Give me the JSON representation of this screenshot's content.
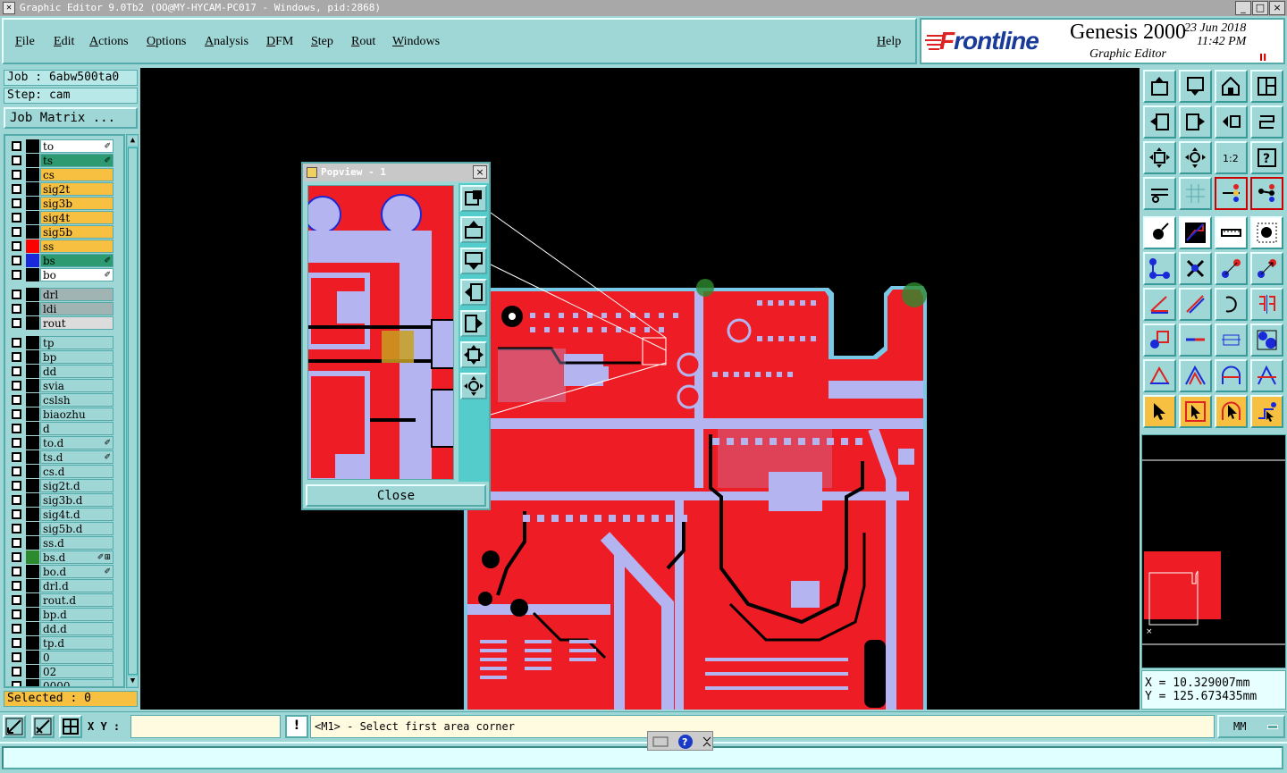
{
  "window": {
    "title": "Graphic Editor 9.0Tb2 (OO@MY-HYCAM-PC017 - Windows, pid:2868)",
    "minimize": "_",
    "maximize": "□",
    "close": "×"
  },
  "menu": [
    "File",
    "Edit",
    "Actions",
    "Options",
    "Analysis",
    "DFM",
    "Step",
    "Rout",
    "Windows"
  ],
  "help_label": "Help",
  "logo": {
    "brand": "Frontline",
    "product": "Genesis 2000",
    "subtitle": "Graphic Editor",
    "date": "23 Jun 2018",
    "time": "11:42 PM",
    "pause": "II"
  },
  "job": {
    "job_label": "Job : 6abw500ta0",
    "step_label": "Step: cam",
    "matrix_button": "Job Matrix ..."
  },
  "layers": [
    {
      "name": "to",
      "bg": "#ffffff",
      "swatch": "#000000",
      "marker": "✐"
    },
    {
      "name": "ts",
      "bg": "#2e9a72",
      "swatch": "#000000",
      "marker": "✐"
    },
    {
      "name": "cs",
      "bg": "#f7c040",
      "swatch": "#000000",
      "marker": ""
    },
    {
      "name": "sig2t",
      "bg": "#f7c040",
      "swatch": "#000000",
      "marker": ""
    },
    {
      "name": "sig3b",
      "bg": "#f7c040",
      "swatch": "#000000",
      "marker": ""
    },
    {
      "name": "sig4t",
      "bg": "#f7c040",
      "swatch": "#000000",
      "marker": ""
    },
    {
      "name": "sig5b",
      "bg": "#f7c040",
      "swatch": "#000000",
      "marker": ""
    },
    {
      "name": "ss",
      "bg": "#f7c040",
      "swatch": "#ff0000",
      "marker": ""
    },
    {
      "name": "bs",
      "bg": "#2e9a72",
      "swatch": "#1a2ad8",
      "marker": "✐"
    },
    {
      "name": "bo",
      "bg": "#ffffff",
      "swatch": "#000000",
      "marker": "✐"
    },
    {
      "name": "drl",
      "bg": "#a0b4b4",
      "swatch": "#000000",
      "marker": ""
    },
    {
      "name": "ldi",
      "bg": "#a0b4b4",
      "swatch": "#000000",
      "marker": ""
    },
    {
      "name": "rout",
      "bg": "#dcdcdc",
      "swatch": "#000000",
      "marker": ""
    },
    {
      "name": "tp",
      "bg": "#9fd6d6",
      "swatch": "#000000",
      "marker": ""
    },
    {
      "name": "bp",
      "bg": "#9fd6d6",
      "swatch": "#000000",
      "marker": ""
    },
    {
      "name": "dd",
      "bg": "#9fd6d6",
      "swatch": "#000000",
      "marker": ""
    },
    {
      "name": "svia",
      "bg": "#9fd6d6",
      "swatch": "#000000",
      "marker": ""
    },
    {
      "name": "cslsh",
      "bg": "#9fd6d6",
      "swatch": "#000000",
      "marker": ""
    },
    {
      "name": "biaozhu",
      "bg": "#9fd6d6",
      "swatch": "#000000",
      "marker": ""
    },
    {
      "name": "d",
      "bg": "#9fd6d6",
      "swatch": "#000000",
      "marker": ""
    },
    {
      "name": "to.d",
      "bg": "#9fd6d6",
      "swatch": "#000000",
      "marker": "✐"
    },
    {
      "name": "ts.d",
      "bg": "#9fd6d6",
      "swatch": "#000000",
      "marker": "✐"
    },
    {
      "name": "cs.d",
      "bg": "#9fd6d6",
      "swatch": "#000000",
      "marker": ""
    },
    {
      "name": "sig2t.d",
      "bg": "#9fd6d6",
      "swatch": "#000000",
      "marker": ""
    },
    {
      "name": "sig3b.d",
      "bg": "#9fd6d6",
      "swatch": "#000000",
      "marker": ""
    },
    {
      "name": "sig4t.d",
      "bg": "#9fd6d6",
      "swatch": "#000000",
      "marker": ""
    },
    {
      "name": "sig5b.d",
      "bg": "#9fd6d6",
      "swatch": "#000000",
      "marker": ""
    },
    {
      "name": "ss.d",
      "bg": "#9fd6d6",
      "swatch": "#000000",
      "marker": ""
    },
    {
      "name": "bs.d",
      "bg": "#9fd6d6",
      "swatch": "#2e8a2e",
      "marker": "✐⊞"
    },
    {
      "name": "bo.d",
      "bg": "#9fd6d6",
      "swatch": "#000000",
      "marker": "✐"
    },
    {
      "name": "drl.d",
      "bg": "#9fd6d6",
      "swatch": "#000000",
      "marker": ""
    },
    {
      "name": "rout.d",
      "bg": "#9fd6d6",
      "swatch": "#000000",
      "marker": ""
    },
    {
      "name": "bp.d",
      "bg": "#9fd6d6",
      "swatch": "#000000",
      "marker": ""
    },
    {
      "name": "dd.d",
      "bg": "#9fd6d6",
      "swatch": "#000000",
      "marker": ""
    },
    {
      "name": "tp.d",
      "bg": "#9fd6d6",
      "swatch": "#000000",
      "marker": ""
    },
    {
      "name": "0",
      "bg": "#9fd6d6",
      "swatch": "#000000",
      "marker": ""
    },
    {
      "name": "02",
      "bg": "#9fd6d6",
      "swatch": "#000000",
      "marker": ""
    },
    {
      "name": "0000",
      "bg": "#9fd6d6",
      "swatch": "#000000",
      "marker": ""
    }
  ],
  "selected_label": "Selected : 0",
  "popview": {
    "title": "Popview - 1",
    "close_label": "Close",
    "close_x": "×"
  },
  "coords": {
    "x": "X = 10.329007mm",
    "y": "Y = 125.673435mm"
  },
  "bottom": {
    "xy_label": "X Y :",
    "xy_value": "",
    "warn": "!",
    "prompt": "<M1> - Select first area corner",
    "units": "MM"
  },
  "colors": {
    "board": "#ee1c24",
    "copper": "#b4b4f0",
    "outline": "#78c8e8",
    "background": "#000000",
    "panel": "#9fd6d6"
  }
}
